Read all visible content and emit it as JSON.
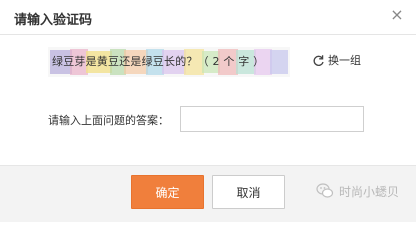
{
  "dialog": {
    "title": "请输入验证码",
    "close_glyph": "×"
  },
  "captcha": {
    "text": "绿豆芽是黄豆还是绿豆长的？（ 2 个 字 ）",
    "refresh_label": "换一组"
  },
  "question": {
    "label": "请输入上面问题的答案：",
    "answer_value": ""
  },
  "buttons": {
    "ok_label": "确定",
    "cancel_label": "取消"
  },
  "watermark": {
    "text": "时尚小蟋贝"
  },
  "colors": {
    "primary": "#f07f3c",
    "footer_bg": "#f3f3f3"
  }
}
